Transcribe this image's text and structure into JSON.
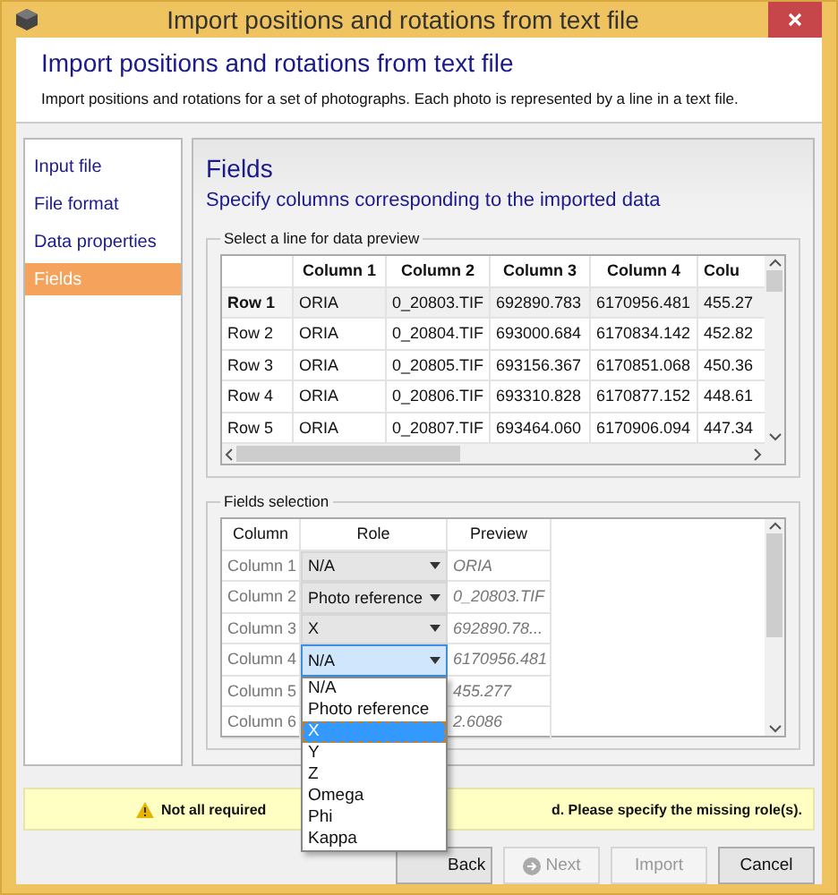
{
  "window": {
    "title": "Import positions and rotations from text file"
  },
  "header": {
    "title": "Import positions and rotations from text file",
    "description": "Import positions and rotations for a set of photographs. Each photo is represented by a line in a text file."
  },
  "nav": {
    "items": [
      {
        "label": "Input file",
        "selected": false
      },
      {
        "label": "File format",
        "selected": false
      },
      {
        "label": "Data properties",
        "selected": false
      },
      {
        "label": "Fields",
        "selected": true
      }
    ]
  },
  "panel": {
    "title": "Fields",
    "subtitle": "Specify columns corresponding to the imported data"
  },
  "preview": {
    "label": "Select a line for data preview",
    "columns": [
      "Column 1",
      "Column 2",
      "Column 3",
      "Column 4",
      "Colu"
    ],
    "rows": [
      {
        "header": "Row 1",
        "selected": true,
        "cells": [
          "ORIA",
          "0_20803.TIF",
          "692890.783",
          "6170956.481",
          "455.27"
        ]
      },
      {
        "header": "Row 2",
        "selected": false,
        "cells": [
          "ORIA",
          "0_20804.TIF",
          "693000.684",
          "6170834.142",
          "452.82"
        ]
      },
      {
        "header": "Row 3",
        "selected": false,
        "cells": [
          "ORIA",
          "0_20805.TIF",
          "693156.367",
          "6170851.068",
          "450.36"
        ]
      },
      {
        "header": "Row 4",
        "selected": false,
        "cells": [
          "ORIA",
          "0_20806.TIF",
          "693310.828",
          "6170877.152",
          "448.61"
        ]
      },
      {
        "header": "Row 5",
        "selected": false,
        "cells": [
          "ORIA",
          "0_20807.TIF",
          "693464.060",
          "6170906.094",
          "447.34"
        ]
      }
    ]
  },
  "fields": {
    "label": "Fields selection",
    "columns": [
      "Column",
      "Role",
      "Preview"
    ],
    "rows": [
      {
        "column": "Column 1",
        "role": "N/A",
        "preview": "ORIA",
        "focused": false
      },
      {
        "column": "Column 2",
        "role": "Photo reference",
        "preview": "0_20803.TIF",
        "focused": false
      },
      {
        "column": "Column 3",
        "role": "X",
        "preview": "692890.78...",
        "focused": false
      },
      {
        "column": "Column 4",
        "role": "N/A",
        "preview": "6170956.481",
        "focused": true
      },
      {
        "column": "Column 5",
        "preview": "455.277"
      },
      {
        "column": "Column 6",
        "preview": "2.6086"
      }
    ]
  },
  "dropdown": {
    "options": [
      {
        "label": "N/A",
        "selected": false
      },
      {
        "label": "Photo reference",
        "selected": false
      },
      {
        "label": "X",
        "selected": true
      },
      {
        "label": "Y",
        "selected": false
      },
      {
        "label": "Z",
        "selected": false
      },
      {
        "label": "Omega",
        "selected": false
      },
      {
        "label": "Phi",
        "selected": false
      },
      {
        "label": "Kappa",
        "selected": false
      }
    ]
  },
  "warning": {
    "text_before": "Not all required",
    "text_after": "d. Please specify the missing role(s)."
  },
  "buttons": [
    {
      "label": "Back",
      "disabled": false,
      "kind": "back"
    },
    {
      "label": "Next",
      "disabled": true,
      "kind": "next"
    },
    {
      "label": "Import",
      "disabled": true,
      "kind": "plain"
    },
    {
      "label": "Cancel",
      "disabled": false,
      "kind": "plain"
    }
  ]
}
